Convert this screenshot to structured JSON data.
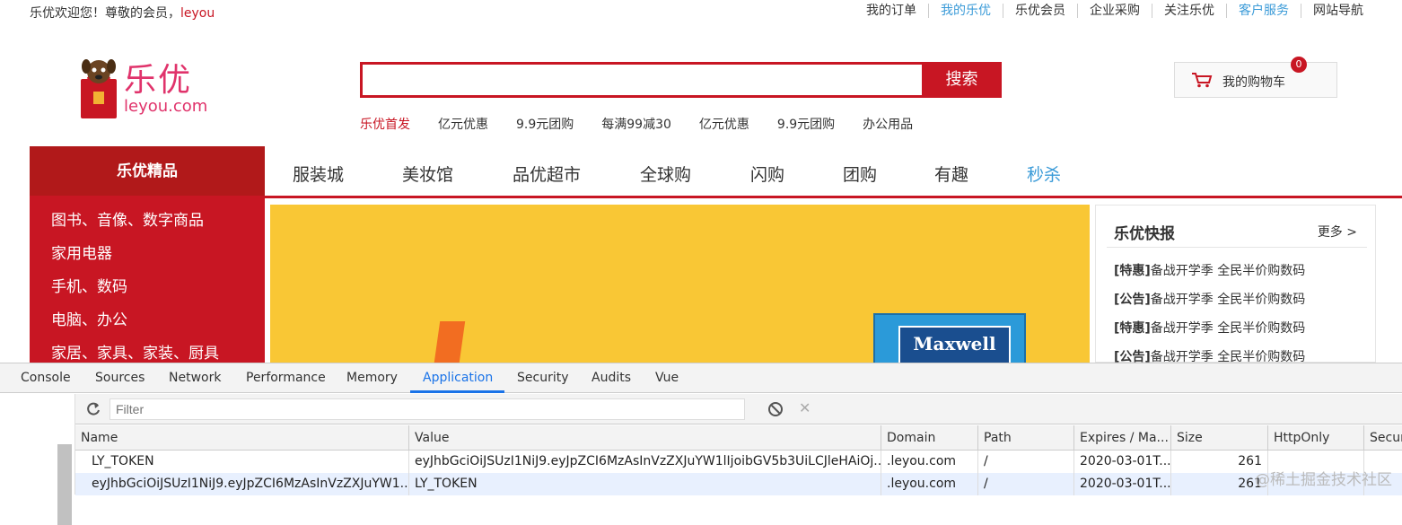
{
  "topbar": {
    "welcome_prefix": "乐优欢迎您！尊敬的会员，",
    "username": "leyou",
    "links": [
      "我的订单",
      "我的乐优",
      "乐优会员",
      "企业采购",
      "关注乐优",
      "客户服务",
      "网站导航"
    ]
  },
  "header": {
    "logo_main": "乐优",
    "logo_sub": "leyou.com",
    "search_placeholder": "",
    "search_button": "搜索",
    "hotwords": [
      "乐优首发",
      "亿元优惠",
      "9.9元团购",
      "每满99减30",
      "亿元优惠",
      "9.9元团购",
      "办公用品"
    ],
    "cart_label": "我的购物车",
    "cart_count": "0"
  },
  "nav": {
    "category_title": "乐优精品",
    "items": [
      "服装城",
      "美妆馆",
      "品优超市",
      "全球购",
      "闪购",
      "团购",
      "有趣",
      "秒杀"
    ]
  },
  "categories": [
    "图书、音像、数字商品",
    "家用电器",
    "手机、数码",
    "电脑、办公",
    "家居、家具、家装、厨具"
  ],
  "banner": {
    "product_text": "Maxwell"
  },
  "news": {
    "title": "乐优快报",
    "more": "更多 >",
    "items": [
      {
        "tag": "[特惠]",
        "text": "备战开学季 全民半价购数码"
      },
      {
        "tag": "[公告]",
        "text": "备战开学季 全民半价购数码"
      },
      {
        "tag": "[特惠]",
        "text": "备战开学季 全民半价购数码"
      },
      {
        "tag": "[公告]",
        "text": "备战开学季 全民半价购数码"
      }
    ]
  },
  "devtools": {
    "tabs": [
      "Console",
      "Sources",
      "Network",
      "Performance",
      "Memory",
      "Application",
      "Security",
      "Audits",
      "Vue"
    ],
    "active_tab": "Application",
    "filter_placeholder": "Filter",
    "columns": [
      "Name",
      "Value",
      "Domain",
      "Path",
      "Expires / Ma...",
      "Size",
      "HttpOnly",
      "Secur"
    ],
    "rows": [
      [
        "LY_TOKEN",
        "eyJhbGciOiJSUzI1NiJ9.eyJpZCI6MzAsInVzZXJuYW1lIjoibGV5b3UiLCJleHAiOj...",
        ".leyou.com",
        "/",
        "2020-03-01T...",
        "261",
        "",
        ""
      ],
      [
        "eyJhbGciOiJSUzI1NiJ9.eyJpZCI6MzAsInVzZXJuYW1...",
        "LY_TOKEN",
        ".leyou.com",
        "/",
        "2020-03-01T...",
        "261",
        "",
        ""
      ]
    ]
  },
  "watermark": "@稀土掘金技术社区"
}
